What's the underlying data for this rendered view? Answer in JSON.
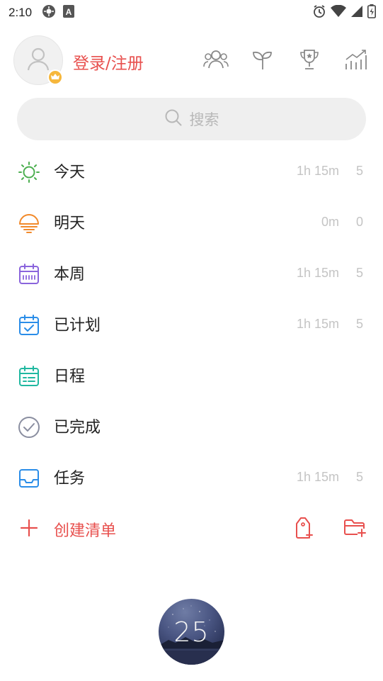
{
  "status_bar": {
    "time": "2:10",
    "left_icons": [
      "settings-icon",
      "a-icon"
    ],
    "right_icons": [
      "alarm-icon",
      "wifi-icon",
      "signal-icon",
      "battery-icon"
    ]
  },
  "header": {
    "login_label": "登录/注册",
    "avatar": "user-icon",
    "badge": "crown-icon",
    "icons": [
      "friends-icon",
      "sprout-icon",
      "trophy-icon",
      "stats-icon"
    ]
  },
  "search": {
    "placeholder": "搜索"
  },
  "list": [
    {
      "label": "今天",
      "time": "1h 15m",
      "count": "5",
      "icon": "sun-icon",
      "color": "#4caf50"
    },
    {
      "label": "明天",
      "time": "0m",
      "count": "0",
      "icon": "sunset-icon",
      "color": "#f28a2b"
    },
    {
      "label": "本周",
      "time": "1h 15m",
      "count": "5",
      "icon": "calendar-week-icon",
      "color": "#8a64dc"
    },
    {
      "label": "已计划",
      "time": "1h 15m",
      "count": "5",
      "icon": "calendar-check-icon",
      "color": "#2a8de8"
    },
    {
      "label": "日程",
      "time": "",
      "count": "",
      "icon": "calendar-schedule-icon",
      "color": "#20b8a0"
    },
    {
      "label": "已完成",
      "time": "",
      "count": "",
      "icon": "check-circle-icon",
      "color": "#8a8ea0"
    },
    {
      "label": "任务",
      "time": "1h 15m",
      "count": "5",
      "icon": "inbox-icon",
      "color": "#2a8de8"
    }
  ],
  "create": {
    "label": "创建清单",
    "color": "#e8504e",
    "icons": [
      "add-tag-icon",
      "add-folder-icon"
    ]
  },
  "timer": {
    "value": "25"
  },
  "colors": {
    "accent": "#e8504e",
    "muted": "#c4c4c4",
    "search_bg": "#efefef"
  }
}
